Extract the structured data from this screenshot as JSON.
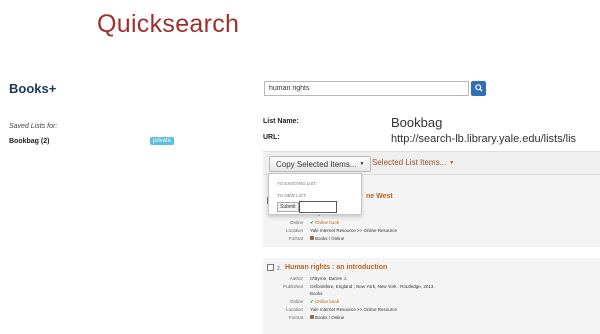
{
  "header": {
    "title": "Quicksearch"
  },
  "section": {
    "title": "Books+"
  },
  "search": {
    "value": "human rights",
    "button_icon": "search-icon"
  },
  "sidebar": {
    "saved_lists_label": "Saved Lists for:",
    "bookbag_link": "Bookbag (2)",
    "privacy_badge": "private"
  },
  "list_info": {
    "list_name_label": "List Name:",
    "list_name_value": "Bookbag",
    "url_label": "URL:",
    "url_value": "http://search-lb.library.yale.edu/lists/lis"
  },
  "toolbar": {
    "copy_label": "Copy Selected Items...",
    "selected_label": "Selected List Items...",
    "caret": "▼"
  },
  "dropdown": {
    "existing_label": "TO EXISTING LIST:",
    "new_label": "TO NEW LIST:",
    "submit_label": "Submit",
    "new_list_value": ""
  },
  "records": [
    {
      "title_partial": "ne West",
      "fields": [
        {
          "label": "",
          "value": "ersity Press, 2013."
        },
        {
          "label": "Online",
          "value": "Online book"
        },
        {
          "label": "Location",
          "value": "Yale Internet Resource >> Online Resource"
        },
        {
          "label": "Format",
          "value": "Books / Online"
        }
      ]
    },
    {
      "number": "2.",
      "title": "Human rights : an introduction",
      "fields": [
        {
          "label": "Author",
          "value": "O'Byrne, Darren J."
        },
        {
          "label": "Published",
          "value": "Oxfordshire, England ; New York, New York : Routledge, 2013."
        },
        {
          "label": "",
          "value": "Books"
        },
        {
          "label": "Online",
          "value": "Online book"
        },
        {
          "label": "Location",
          "value": "Yale Internet Resource >> Online Resource"
        },
        {
          "label": "Format",
          "value": "Books / Online"
        }
      ]
    }
  ],
  "colors": {
    "brand": "#a0302d",
    "accent": "#2f6fb8",
    "badge": "#5bc0de",
    "link": "#b5651d"
  }
}
